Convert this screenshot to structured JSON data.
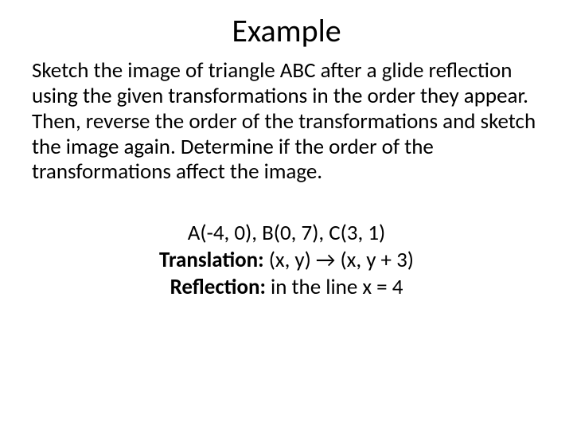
{
  "title": "Example",
  "instructions": "Sketch the image of triangle ABC after a glide reflection using the given transformations in the order they appear.  Then, reverse the order of the transformations and sketch the image again.  Determine if the order of the transformations affect the image.",
  "points": "A(-4, 0), B(0, 7), C(3, 1)",
  "translation_label": "Translation:",
  "translation_value": "(x, y) → (x, y + 3)",
  "reflection_label": "Reflection:",
  "reflection_value": "in the line x = 4"
}
